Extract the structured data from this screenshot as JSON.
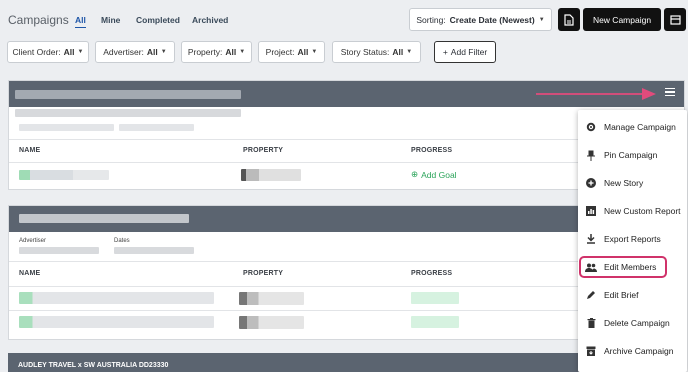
{
  "header": {
    "title": "Campaigns",
    "tabs": [
      "All",
      "Mine",
      "Completed",
      "Archived"
    ],
    "active_tab": "All"
  },
  "toolbar": {
    "sort_label": "Sorting:",
    "sort_value": "Create Date (Newest)",
    "new_campaign": "New Campaign"
  },
  "filters": [
    {
      "label": "Client Order:",
      "value": "All"
    },
    {
      "label": "Advertiser:",
      "value": "All"
    },
    {
      "label": "Property:",
      "value": "All"
    },
    {
      "label": "Project:",
      "value": "All"
    },
    {
      "label": "Story Status:",
      "value": "All"
    }
  ],
  "add_filter": "Add Filter",
  "table": {
    "col_name": "NAME",
    "col_property": "PROPERTY",
    "col_progress": "PROGRESS"
  },
  "add_goal": "Add Goal",
  "card2": {
    "advertiser_label": "Advertiser",
    "dates_label": "Dates"
  },
  "card3": {
    "title": "AUDLEY TRAVEL x SW AUSTRALIA DD23330"
  },
  "menu": {
    "items": [
      "Manage Campaign",
      "Pin Campaign",
      "New Story",
      "New Custom Report",
      "Export Reports",
      "Edit Members",
      "Edit Brief",
      "Delete Campaign",
      "Archive Campaign"
    ]
  },
  "colors": {
    "accent": "#1f56a8",
    "highlight": "#d0326a",
    "arrow": "#e24b7c",
    "goal": "#2ba45a",
    "card_header": "#5b6470"
  }
}
